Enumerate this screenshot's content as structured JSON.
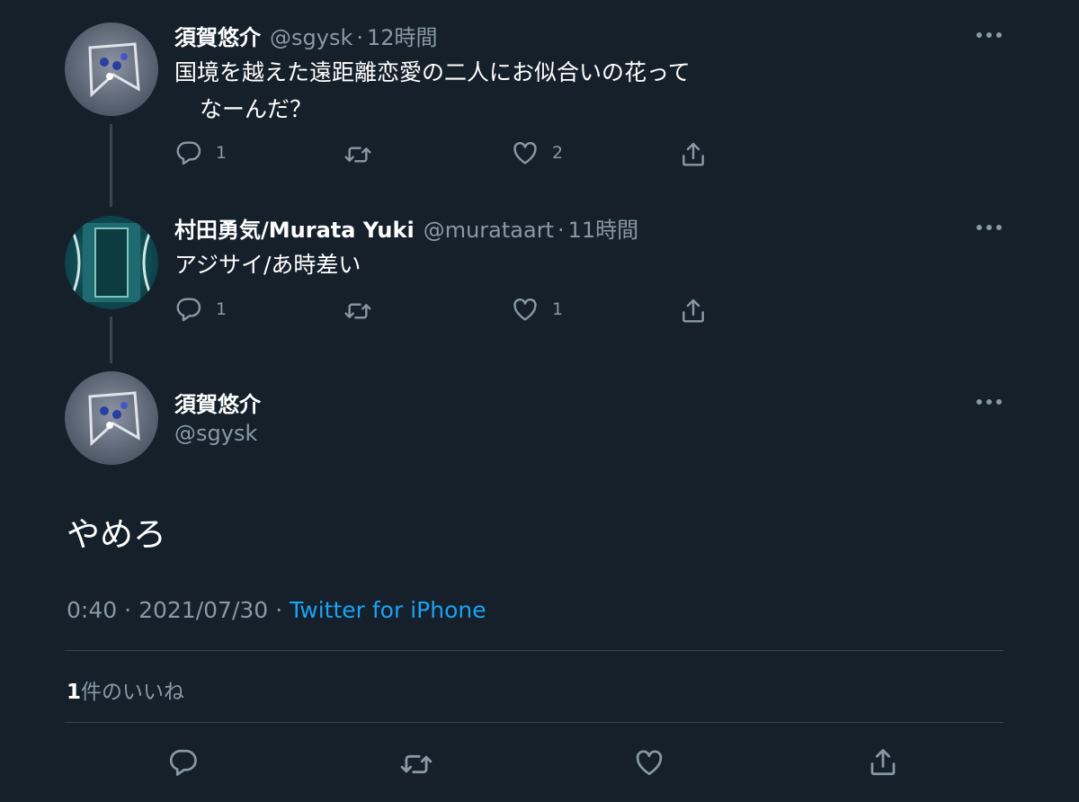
{
  "thread": [
    {
      "display_name": "須賀悠介",
      "handle": "@sgysk",
      "separator": "·",
      "time": "12時間",
      "text_line1": "国境を越えた遠距離恋愛の二人にお似合いの花って",
      "text_line2": "なーんだ？",
      "replies": "1",
      "retweets": "",
      "likes": "2"
    },
    {
      "display_name": "村田勇気/Murata Yuki",
      "handle": "@murataart",
      "separator": "·",
      "time": "11時間",
      "text_line1": "アジサイ/あ時差い",
      "replies": "1",
      "retweets": "",
      "likes": "1"
    }
  ],
  "main_tweet": {
    "display_name": "須賀悠介",
    "handle": "@sgysk",
    "text": "やめろ",
    "time": "0:40",
    "date": "2021/07/30",
    "separator": "·",
    "source": "Twitter for iPhone",
    "likes_count": "1",
    "likes_label": "件のいいね"
  },
  "colors": {
    "background": "#15202b",
    "text_primary": "#ffffff",
    "text_secondary": "#8899a6",
    "link": "#1da1f2",
    "divider": "#38444d"
  },
  "icons": [
    "reply-icon",
    "retweet-icon",
    "like-icon",
    "share-icon",
    "more-icon"
  ]
}
